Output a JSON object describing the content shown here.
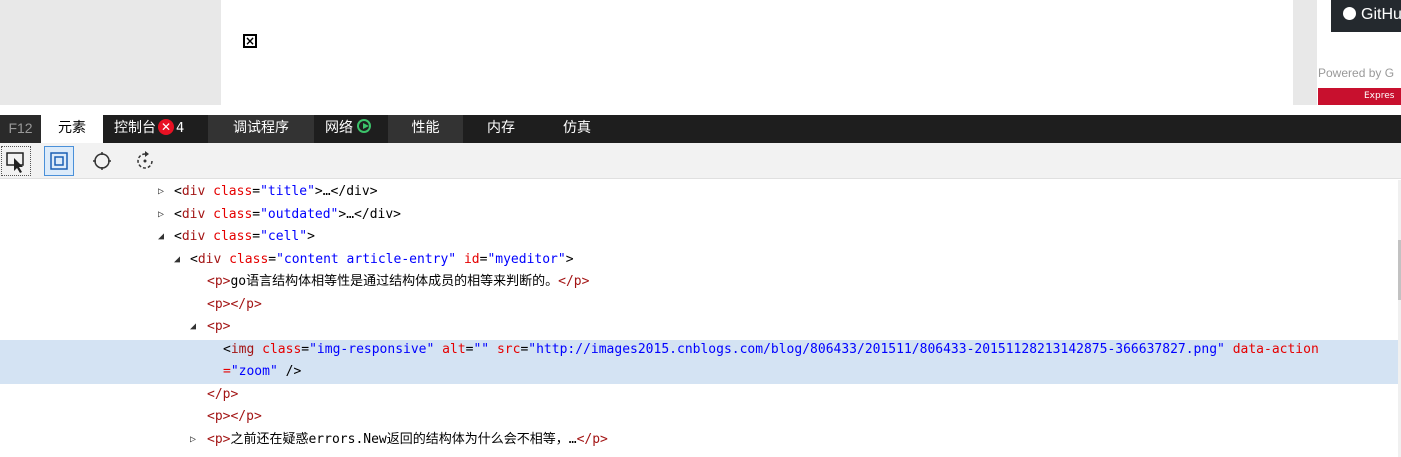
{
  "page": {
    "github_label": "GitHu",
    "powered_by": "Powered by G",
    "express_label": "Expres",
    "resize_grip": "...",
    "broken_image_glyph": "×"
  },
  "devtools": {
    "tabs": [
      {
        "label": "F12"
      },
      {
        "label": "元素"
      },
      {
        "label": "控制台"
      },
      {
        "label": "调试程序"
      },
      {
        "label": "网络"
      },
      {
        "label": "性能"
      },
      {
        "label": "内存"
      },
      {
        "label": "仿真"
      }
    ],
    "console_error_count": "4",
    "toolbar_icons": [
      "select-element-icon",
      "highlight-box-icon",
      "target-icon",
      "refresh-rotate-icon"
    ]
  },
  "dom_lines": [
    {
      "tag_open": "<",
      "name": "div",
      "attr1": "class",
      "val1": "\"title\"",
      "close": ">…</div>"
    },
    {
      "tag_open": "<",
      "name": "div",
      "attr1": "class",
      "val1": "\"outdated\"",
      "close": ">…</div>"
    },
    {
      "tag_open": "<",
      "name": "div",
      "attr1": "class",
      "val1": "\"cell\"",
      "close": ">"
    },
    {
      "tag_open": "<",
      "name": "div",
      "attr1": "class",
      "val1": "\"content article-entry\"",
      "attr2": "id",
      "val2": "\"myeditor\"",
      "close": ">"
    },
    {
      "open": "<p>",
      "text": "go语言结构体相等性是通过结构体成员的相等来判断的。",
      "close": "</p>"
    },
    {
      "open": "<p></p>"
    },
    {
      "open": "<p>"
    },
    {
      "name": "img",
      "a1": "class",
      "v1": "\"img-responsive\"",
      "a2": "alt",
      "v2": "\"\"",
      "a3": "src",
      "v3": "\"http://images2015.cnblogs.com/blog/806433/201511/806433-20151128213142875-366637827.png\"",
      "a4": "data-action",
      "cont_eq": "=",
      "v4": "\"zoom\"",
      "end": " />"
    },
    {
      "open": "</p>"
    },
    {
      "open": "<p></p>"
    },
    {
      "open": "<p>",
      "text": "之前还在疑惑errors.New返回的结构体为什么会不相等，…",
      "close": "</p>"
    }
  ],
  "colors": {
    "selected_row": "#d4e3f3",
    "tab_bar": "#1e1e1e",
    "error_badge": "#e81123",
    "network_play": "#3cc36a",
    "tag_name": "#a31515",
    "attr_name": "#e50000",
    "attr_value": "#0000ff"
  }
}
